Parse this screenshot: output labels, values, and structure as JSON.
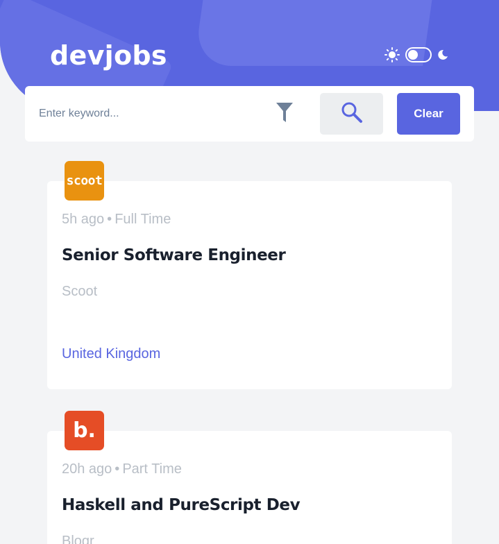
{
  "header": {
    "logo": "devjobs",
    "theme_toggle": {
      "mode": "light"
    },
    "colors": {
      "brand": "#5965e0"
    }
  },
  "search": {
    "placeholder": "Enter keyword...",
    "value": "",
    "filter_icon": "filter-icon",
    "search_icon": "search-icon",
    "clear_label": "Clear"
  },
  "jobs": [
    {
      "logo_text": "scoot",
      "logo_color": "#e99210",
      "posted": "5h ago",
      "contract": "Full Time",
      "position": "Senior Software Engineer",
      "company": "Scoot",
      "location": "United Kingdom"
    },
    {
      "logo_text": "b.",
      "logo_color": "#e54d26",
      "posted": "20h ago",
      "contract": "Part Time",
      "position": "Haskell and PureScript Dev",
      "company": "Blogr"
    }
  ],
  "separator": "•"
}
